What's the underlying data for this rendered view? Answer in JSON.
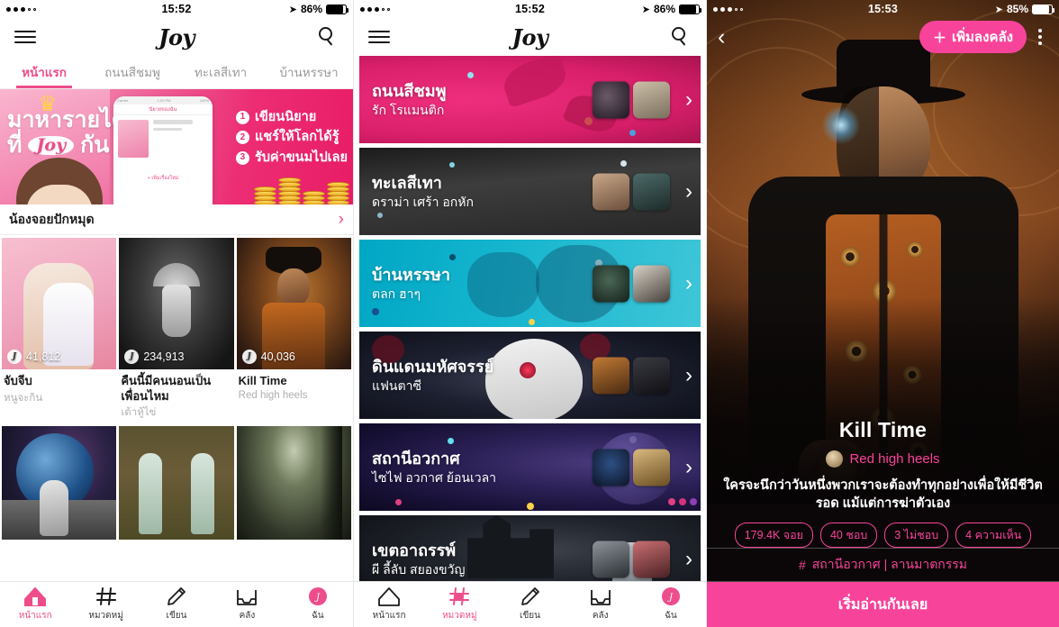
{
  "status_bars": [
    {
      "time": "15:52",
      "battery": "86%",
      "signal_filled": 3,
      "signal_empty": 2
    },
    {
      "time": "15:52",
      "battery": "86%",
      "signal_filled": 3,
      "signal_empty": 2
    },
    {
      "time": "15:53",
      "battery": "85%",
      "signal_filled": 3,
      "signal_empty": 2
    }
  ],
  "colors": {
    "accent_pink": "#ee4d8b",
    "hot_pink": "#f8439a",
    "muted_gray": "#9a9a9a"
  },
  "app": {
    "brand": "Joy",
    "menu_icon": "hamburger-icon",
    "search_icon": "search-icon"
  },
  "screen1": {
    "tabs": [
      {
        "label": "หน้าแรก",
        "active": true
      },
      {
        "label": "ถนนสีชมพู",
        "active": false
      },
      {
        "label": "ทะเลสีเทา",
        "active": false
      },
      {
        "label": "บ้านหรรษา",
        "active": false
      }
    ],
    "promo": {
      "headline_line1": "มาหารายได้",
      "headline_line2_pre": "ที่",
      "headline_brand": "Joy",
      "headline_line2_post": "กัน",
      "steps": [
        {
          "num": "1",
          "text": "เขียนนิยาย"
        },
        {
          "num": "2",
          "text": "แชร์ให้โลกได้รู้"
        },
        {
          "num": "3",
          "text": "รับค่าขนมไปเลย"
        }
      ],
      "phone_header": "นิยายของฉัน",
      "phone_item_title": "บทที่รัก",
      "phone_item_date": "11/05/2017",
      "phone_add": "+ เพิ่มเรื่องใหม่",
      "phone_carrier": "Carrier",
      "phone_time": "1:20 PM",
      "phone_battery": "100%"
    },
    "section": {
      "title": "น้องจอยปักหมุด",
      "chevron": "chevron-right-icon"
    },
    "cards_row1": [
      {
        "views": "41,812",
        "title": "จับจีบ",
        "author": "หนูจะกิน",
        "img": "two-women-pink"
      },
      {
        "views": "234,913",
        "title": "คืนนี้มีคนนอนเป็นเพื่อนไหม",
        "author": "เต้าหู้ไข่",
        "img": "ghost-umbrella-forest"
      },
      {
        "views": "40,036",
        "title": "Kill Time",
        "author": "Red high heels",
        "img": "steampunk-man"
      }
    ],
    "cards_row2": [
      {
        "img": "astronaut-moon-earth"
      },
      {
        "img": "twin-women-field"
      },
      {
        "img": "dark-foggy-forest"
      }
    ]
  },
  "screen2": {
    "categories": [
      {
        "title": "ถนนสีชมพู",
        "subtitle": "รัก โรแมนติก",
        "theme": "pink"
      },
      {
        "title": "ทะเลสีเทา",
        "subtitle": "ดราม่า เศร้า อกหัก",
        "theme": "gray"
      },
      {
        "title": "บ้านหรรษา",
        "subtitle": "ตลก ฮาๆ",
        "theme": "cyan"
      },
      {
        "title": "ดินแดนมหัศจรรย์",
        "subtitle": "แฟนตาซี",
        "theme": "rabbit"
      },
      {
        "title": "สถานีอวกาศ",
        "subtitle": "ไซไฟ อวกาศ ย้อนเวลา",
        "theme": "space"
      },
      {
        "title": "เขตอาถรรพ์",
        "subtitle": "ผี ลี้ลับ สยองขวัญ",
        "theme": "horror"
      }
    ],
    "chevron": "chevron-right-icon"
  },
  "screen3": {
    "back_icon": "chevron-left-icon",
    "add_button": "เพิ่มลงคลัง",
    "add_icon": "plus-icon",
    "more_icon": "kebab-menu-icon",
    "title": "Kill Time",
    "author": "Red high heels",
    "description": "ใครจะนึกว่าวันหนึ่งพวกเราจะต้องทำทุกอย่างเพื่อให้มีชีวิตรอด แม้แต่การฆ่าตัวเอง",
    "stats": [
      {
        "label": "179.4K จอย"
      },
      {
        "label": "40 ชอบ"
      },
      {
        "label": "3 ไม่ชอบ"
      },
      {
        "label": "4 ความเห็น"
      }
    ],
    "tags_icon": "hashtag-icon",
    "tags": "สถานีอวกาศ | ลานมาตกรรม",
    "cta": "เริ่มอ่านกันเลย"
  },
  "bottom_nav": [
    {
      "label": "หน้าแรก",
      "icon": "home-icon"
    },
    {
      "label": "หมวดหมู่",
      "icon": "hashtag-icon"
    },
    {
      "label": "เขียน",
      "icon": "pencil-icon"
    },
    {
      "label": "คลัง",
      "icon": "tray-icon"
    },
    {
      "label": "ฉัน",
      "icon": "profile-icon"
    }
  ],
  "bottom_nav_active": [
    0,
    1
  ]
}
